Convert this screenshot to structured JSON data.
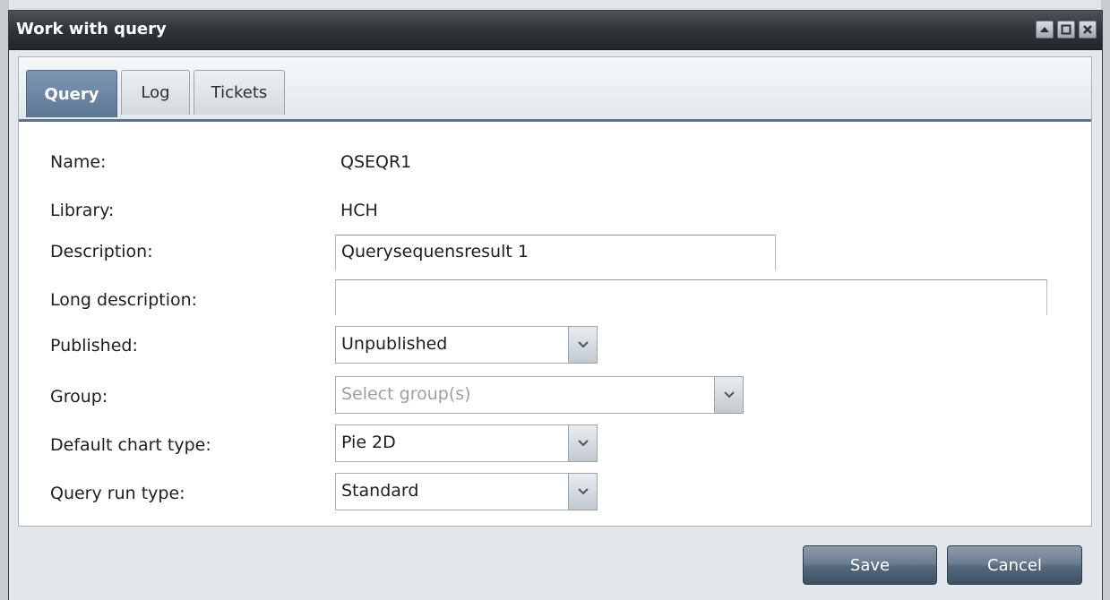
{
  "window": {
    "title": "Work with query",
    "controls": [
      "minimize-icon",
      "maximize-icon",
      "close-icon"
    ]
  },
  "tabs": [
    {
      "label": "Query",
      "active": true
    },
    {
      "label": "Log",
      "active": false
    },
    {
      "label": "Tickets",
      "active": false
    }
  ],
  "form": {
    "name": {
      "label": "Name:",
      "value": "QSEQR1"
    },
    "library": {
      "label": "Library:",
      "value": "HCH"
    },
    "description": {
      "label": "Description:",
      "value": "Querysequensresult 1"
    },
    "long_description": {
      "label": "Long description:",
      "value": ""
    },
    "published": {
      "label": "Published:",
      "value": "Unpublished"
    },
    "group": {
      "label": "Group:",
      "placeholder": "Select group(s)"
    },
    "default_chart_type": {
      "label": "Default chart type:",
      "value": "Pie 2D"
    },
    "query_run_type": {
      "label": "Query run type:",
      "value": "Standard"
    }
  },
  "buttons": {
    "save": "Save",
    "cancel": "Cancel"
  },
  "colors": {
    "titlebar": "#2f3439",
    "active_tab": "#6f89a6",
    "button": "#5d7084"
  }
}
